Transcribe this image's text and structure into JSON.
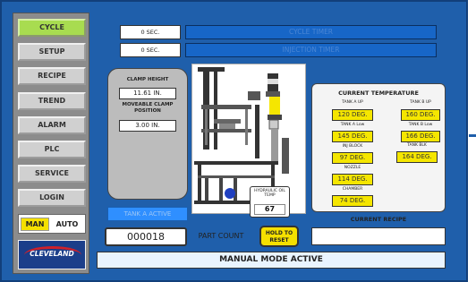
{
  "sidebar": {
    "items": [
      {
        "label": "CYCLE",
        "active": true
      },
      {
        "label": "SETUP",
        "active": false
      },
      {
        "label": "RECIPE",
        "active": false
      },
      {
        "label": "TREND",
        "active": false
      },
      {
        "label": "ALARM",
        "active": false
      },
      {
        "label": "PLC",
        "active": false
      },
      {
        "label": "SERVICE",
        "active": false
      },
      {
        "label": "LOGIN",
        "active": false
      }
    ],
    "mode_toggle": {
      "man": "MAN",
      "auto": "AUTO",
      "selected": "MAN"
    },
    "logo": {
      "text": "CLEVELAND"
    }
  },
  "timers": {
    "cycle": {
      "value": "0 SEC.",
      "label": "CYCLE TIMER"
    },
    "injection": {
      "value": "0 SEC.",
      "label": "INJECTION TIMER"
    }
  },
  "clamp": {
    "height_label": "CLAMP HEIGHT",
    "height_value": "11.61 IN.",
    "position_label": "MOVEABLE CLAMP POSITION",
    "position_value": "3.00 IN."
  },
  "temperature": {
    "title": "CURRENT TEMPERATURE",
    "tank_a_up": {
      "label": "TANK A UP",
      "value": "120 DEG."
    },
    "tank_b_up": {
      "label": "TANK B UP",
      "value": "160 DEG."
    },
    "tank_a_low": {
      "label": "TANK A Low",
      "value": "145 DEG."
    },
    "tank_b_low": {
      "label": "TANK B Low",
      "value": "166 DEG."
    },
    "inj_block": {
      "label": "INJ BLOCK",
      "value": "97 DEG."
    },
    "tank_blk": {
      "label": "TANK BLK",
      "value": "164 DEG."
    },
    "nozzle": {
      "label": "NOZZLE",
      "value": "114 DEG."
    },
    "chamber": {
      "label": "CHAMBER",
      "value": "74 DEG."
    }
  },
  "hydraulic": {
    "label": "HYDRAULIC OIL TEMP",
    "value": "67"
  },
  "tank_status": "TANK A ACTIVE",
  "recipe": {
    "label": "CURRENT RECIPE",
    "value": ""
  },
  "part_count": {
    "value": "000018",
    "label": "PART COUNT"
  },
  "hold_reset": "HOLD TO RESET",
  "mode_banner": "MANUAL MODE ACTIVE",
  "colors": {
    "panel_blue": "#1f5fab",
    "active_green": "#a8dc50",
    "value_yellow": "#f5e600",
    "timer_blue": "#1766c7"
  }
}
